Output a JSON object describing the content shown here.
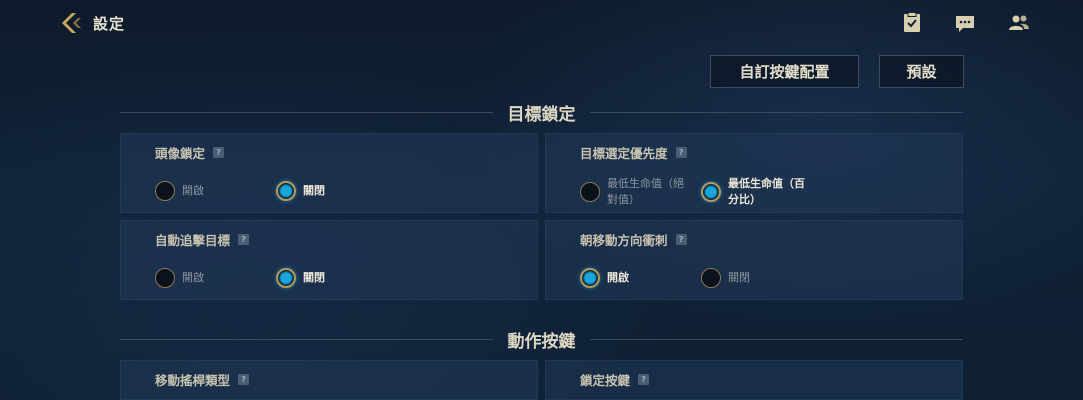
{
  "header": {
    "title": "設定"
  },
  "toolbar": {
    "custom_keys_label": "自訂按鍵配置",
    "default_label": "預設"
  },
  "sections": [
    {
      "title": "目標鎖定"
    },
    {
      "title": "動作按鍵"
    }
  ],
  "panels": {
    "portrait_lock": {
      "title": "頭像鎖定",
      "help": "?",
      "options": [
        "開啟",
        "關閉"
      ],
      "selected": "關閉"
    },
    "target_priority": {
      "title": "目標選定優先度",
      "help": "?",
      "options": [
        "最低生命值（絕\n對值）",
        "最低生命值（百\n分比）"
      ],
      "option_line1": [
        "最低生命值（絕",
        "最低生命值（百"
      ],
      "option_line2": [
        "對值）",
        "分比）"
      ],
      "selected": "最低生命值（百分比）"
    },
    "auto_chase": {
      "title": "自動追擊目標",
      "help": "?",
      "options": [
        "開啟",
        "關閉"
      ],
      "selected": "關閉"
    },
    "dash_move_dir": {
      "title": "朝移動方向衝刺",
      "help": "?",
      "options": [
        "開啟",
        "關閉"
      ],
      "selected": "開啟"
    },
    "joystick_type": {
      "title": "移動搖桿類型",
      "help": "?"
    },
    "lock_button": {
      "title": "鎖定按鍵",
      "help": "?"
    }
  }
}
